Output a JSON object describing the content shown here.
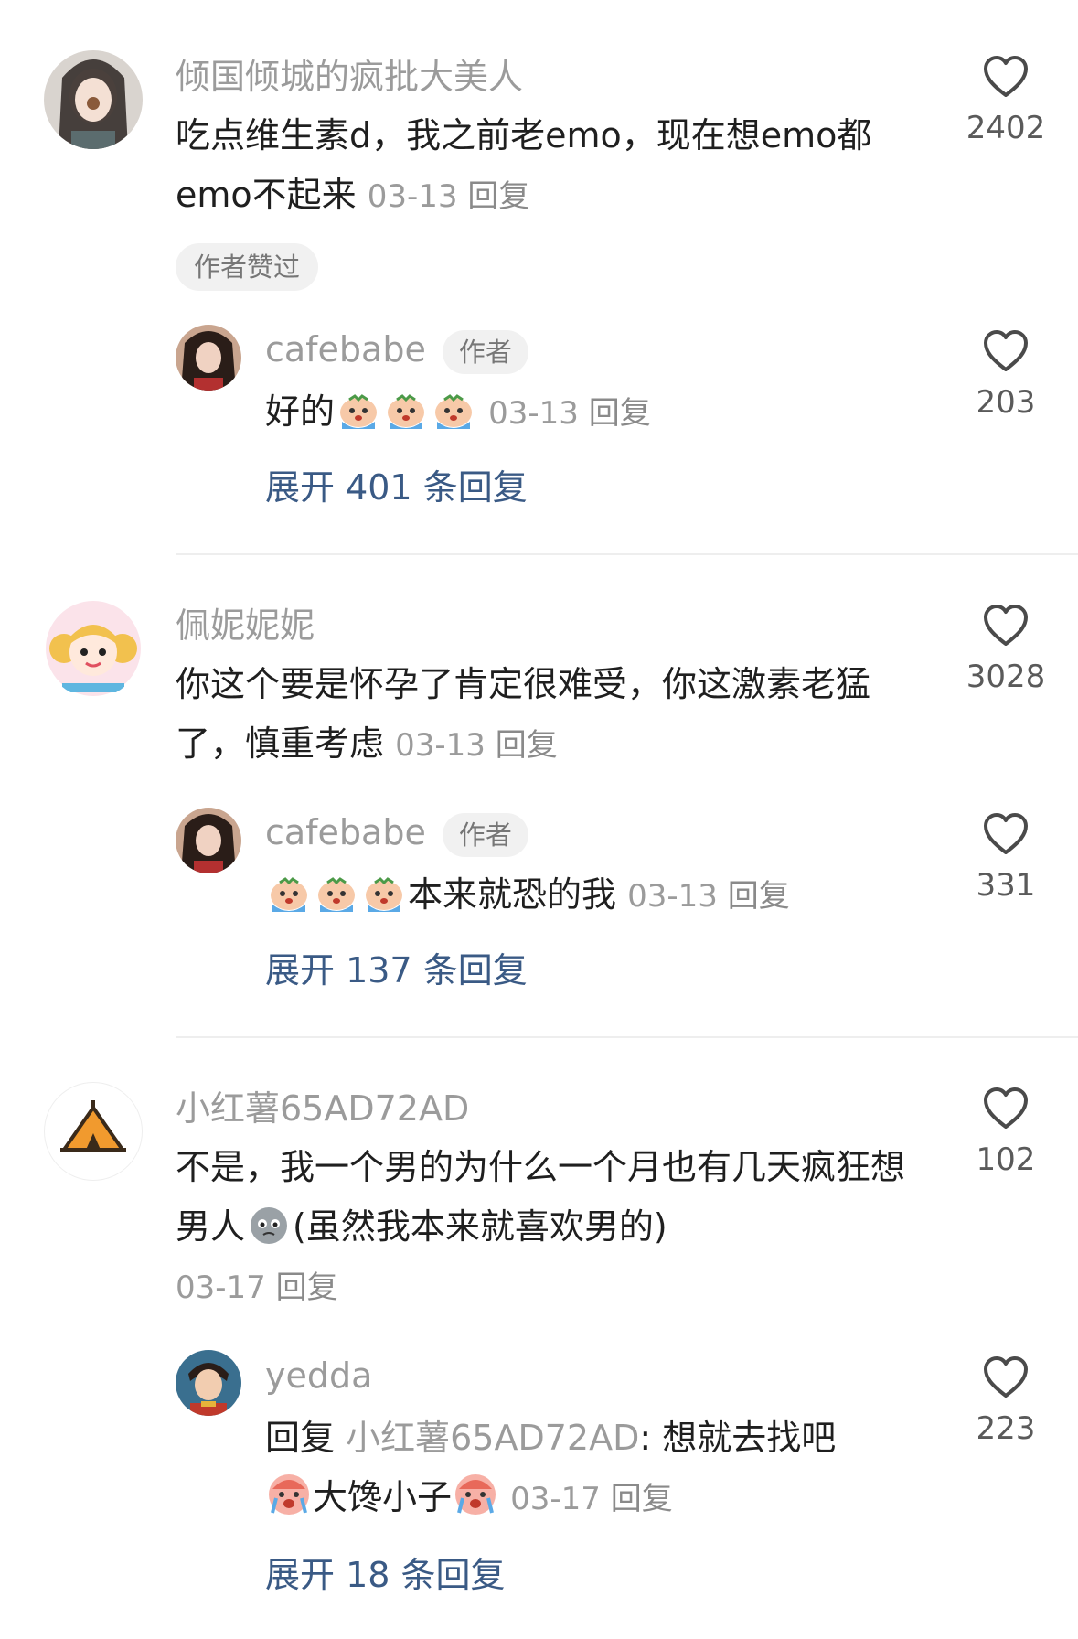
{
  "comments": [
    {
      "username": "倾国倾城的疯批大美人",
      "text": "吃点维生素d，我之前老emo，现在想emo都emo不起来",
      "date": "03-13",
      "reply_label": "回复",
      "likes": "2402",
      "badge": "作者赞过",
      "replies": [
        {
          "username": "cafebabe",
          "author_tag": "作者",
          "text": "好的",
          "emoji_after": [
            "crying-emoji",
            "crying-emoji",
            "crying-emoji"
          ],
          "date": "03-13",
          "reply_label": "回复",
          "likes": "203"
        }
      ],
      "expand_label": "展开 401 条回复"
    },
    {
      "username": "佩妮妮妮",
      "text": "你这个要是怀孕了肯定很难受，你这激素老猛了，慎重考虑",
      "date": "03-13",
      "reply_label": "回复",
      "likes": "3028",
      "replies": [
        {
          "username": "cafebabe",
          "author_tag": "作者",
          "emoji_before": [
            "crying-emoji",
            "crying-emoji",
            "crying-emoji"
          ],
          "text": "本来就恐的我",
          "date": "03-13",
          "reply_label": "回复",
          "likes": "331"
        }
      ],
      "expand_label": "展开 137 条回复"
    },
    {
      "username": "小红薯65AD72AD",
      "text_part1": "不是，我一个男的为什么一个月也有几天疯狂想男人",
      "text_part2": "(虽然我本来就喜欢男的)",
      "emoji_mid": "grey-face-emoji",
      "date": "03-17",
      "reply_label": "回复",
      "likes": "102",
      "replies": [
        {
          "username": "yedda",
          "prefix": "回复",
          "mention": "小红薯65AD72AD",
          "text": ": 想就去找吧",
          "text_mid": "大馋小子",
          "date": "03-17",
          "reply_label": "回复",
          "likes": "223"
        }
      ],
      "expand_label": "展开 18 条回复"
    }
  ],
  "colors": {
    "name": "#9b9b9b",
    "text": "#1f1f1f",
    "expand": "#3a5a85",
    "badge_bg": "#f1f1f1"
  }
}
